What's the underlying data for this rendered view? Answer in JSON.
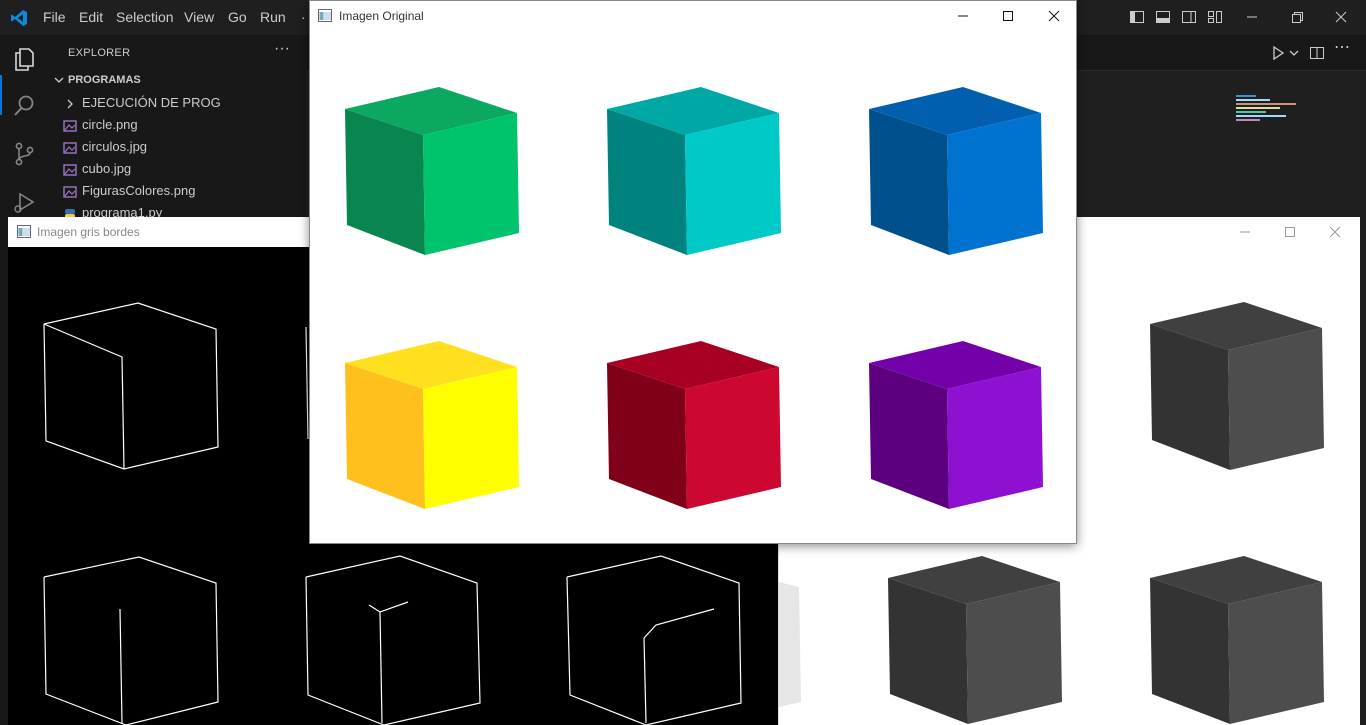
{
  "menubar": {
    "items": [
      "File",
      "Edit",
      "Selection",
      "View",
      "Go",
      "Run",
      "·"
    ]
  },
  "sidebar": {
    "title": "EXPLORER",
    "more": "···",
    "folder": "PROGRAMAS",
    "items": [
      {
        "label": "EJECUCIÓN DE PROG",
        "icon": "chevron-right-icon"
      },
      {
        "label": "circle.png",
        "icon": "image-file-icon"
      },
      {
        "label": "circulos.jpg",
        "icon": "image-file-icon"
      },
      {
        "label": "cubo.jpg",
        "icon": "image-file-icon"
      },
      {
        "label": "FigurasColores.png",
        "icon": "image-file-icon"
      },
      {
        "label": "programa1.py",
        "icon": "python-file-icon"
      }
    ]
  },
  "windows": {
    "edges": {
      "title": "Imagen gris bordes"
    },
    "gray": {
      "title": ""
    },
    "original": {
      "title": "Imagen Original"
    }
  },
  "colors": {
    "accent": "#0078d4",
    "cubes": [
      {
        "left": "#09864f",
        "right": "#00c46b",
        "top": "#0aa860"
      },
      {
        "left": "#00827e",
        "right": "#00cac7",
        "top": "#00a8a5"
      },
      {
        "left": "#01508e",
        "right": "#0073d0",
        "top": "#025fb0"
      },
      {
        "left": "#ffbf1c",
        "right": "#ffff00",
        "top": "#ffe01e"
      },
      {
        "left": "#7f0018",
        "right": "#cc0730",
        "top": "#a80022"
      },
      {
        "left": "#5c0080",
        "right": "#8e10d0",
        "top": "#7300a8"
      }
    ],
    "gray": {
      "left": "#333333",
      "right": "#4d4d4d",
      "top": "#404040"
    }
  }
}
